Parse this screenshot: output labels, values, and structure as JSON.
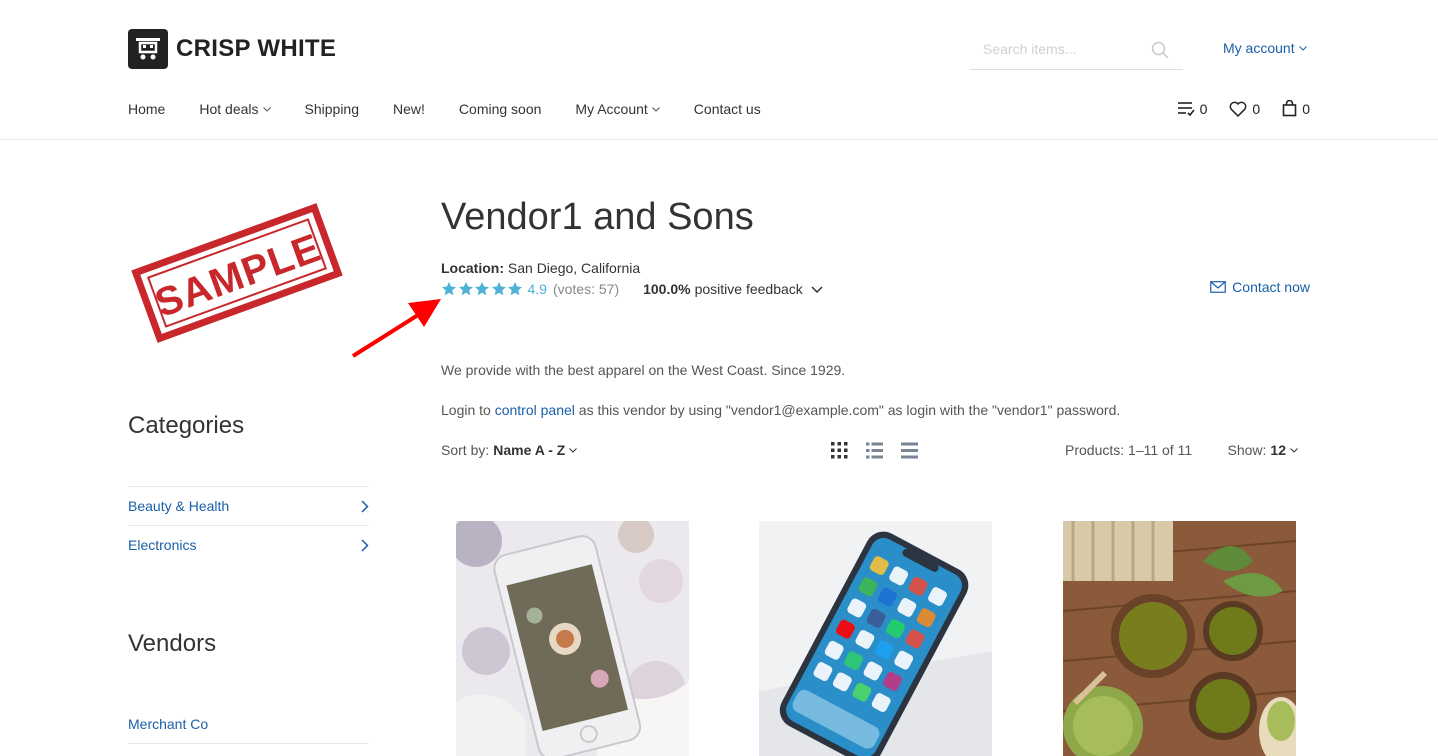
{
  "brand": {
    "name": "CRISP WHITE"
  },
  "search": {
    "placeholder": "Search items..."
  },
  "account": {
    "label": "My account"
  },
  "nav": {
    "items": [
      {
        "label": "Home",
        "dropdown": false
      },
      {
        "label": "Hot deals",
        "dropdown": true
      },
      {
        "label": "Shipping",
        "dropdown": false
      },
      {
        "label": "New!",
        "dropdown": false
      },
      {
        "label": "Coming soon",
        "dropdown": false
      },
      {
        "label": "My Account",
        "dropdown": true
      },
      {
        "label": "Contact us",
        "dropdown": false
      }
    ]
  },
  "counters": {
    "compare": "0",
    "wishlist": "0",
    "cart": "0"
  },
  "sidebar": {
    "logo_text": "SAMPLE",
    "categories_heading": "Categories",
    "categories": [
      {
        "label": "Beauty & Health"
      },
      {
        "label": "Electronics"
      }
    ],
    "vendors_heading": "Vendors",
    "vendors": [
      {
        "label": "Merchant Co"
      }
    ]
  },
  "vendor": {
    "title": "Vendor1 and Sons",
    "location_label": "Location:",
    "location_value": "San Diego, California",
    "rating": "4.9",
    "rating_stars": 4.9,
    "votes": "(votes: 57)",
    "feedback_pct": "100.0%",
    "feedback_label": "positive feedback",
    "contact_label": "Contact now",
    "description": "We provide with the best apparel on the West Coast. Since 1929.",
    "login_prefix": "Login to",
    "login_link": "control panel",
    "login_suffix": "as this vendor by using \"vendor1@example.com\" as login with the \"vendor1\" password."
  },
  "listing": {
    "sort_label": "Sort by:",
    "sort_value": "Name A - Z",
    "products_count": "Products: 1–11 of 11",
    "show_label": "Show:",
    "show_value": "12"
  },
  "colors": {
    "accent": "#1a5fa8",
    "star": "#4fb1d6",
    "annotation_arrow": "#ff0000"
  }
}
